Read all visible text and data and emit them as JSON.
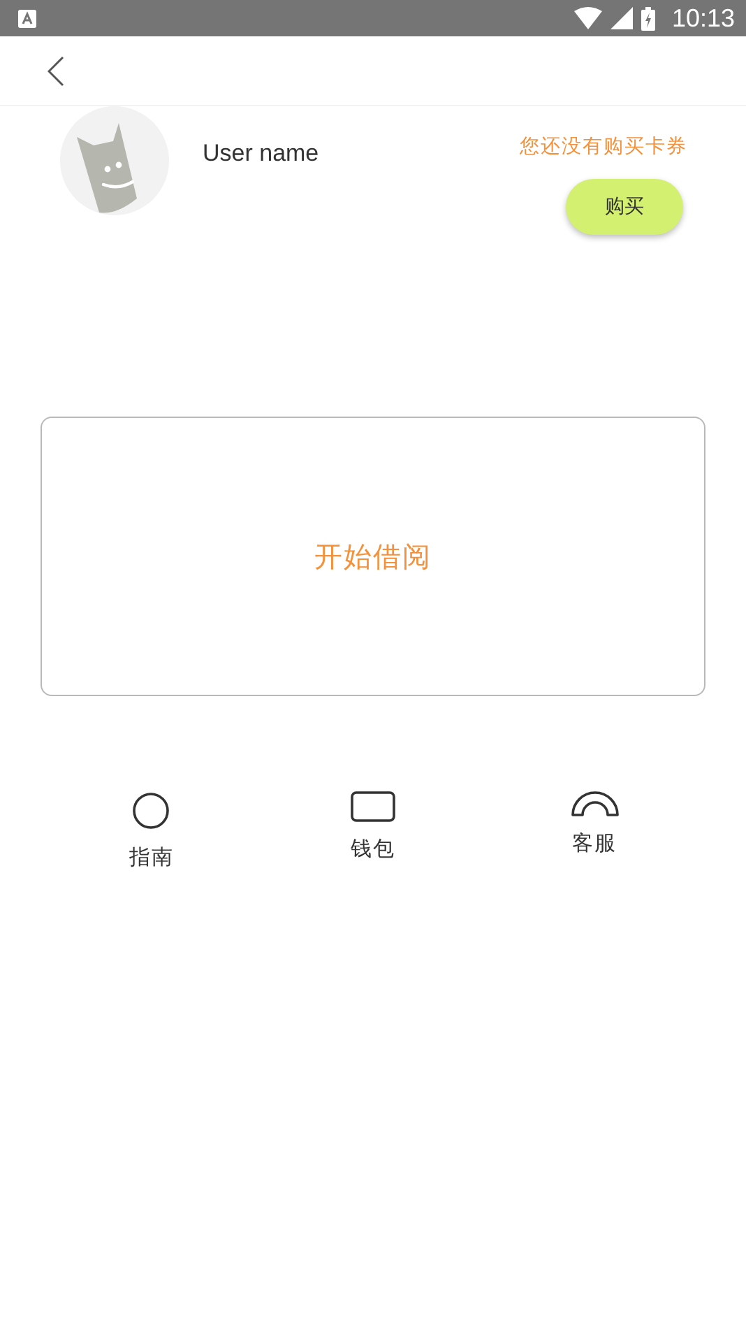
{
  "status_bar": {
    "time": "10:13"
  },
  "profile": {
    "user_name": "User name",
    "notice": "您还没有购买卡券",
    "buy_button": "购买"
  },
  "borrow_card": {
    "label": "开始借阅"
  },
  "shortcuts": [
    {
      "kind": "circle",
      "label": "指南"
    },
    {
      "kind": "rectangle",
      "label": "钱包"
    },
    {
      "kind": "arch",
      "label": "客服"
    }
  ]
}
